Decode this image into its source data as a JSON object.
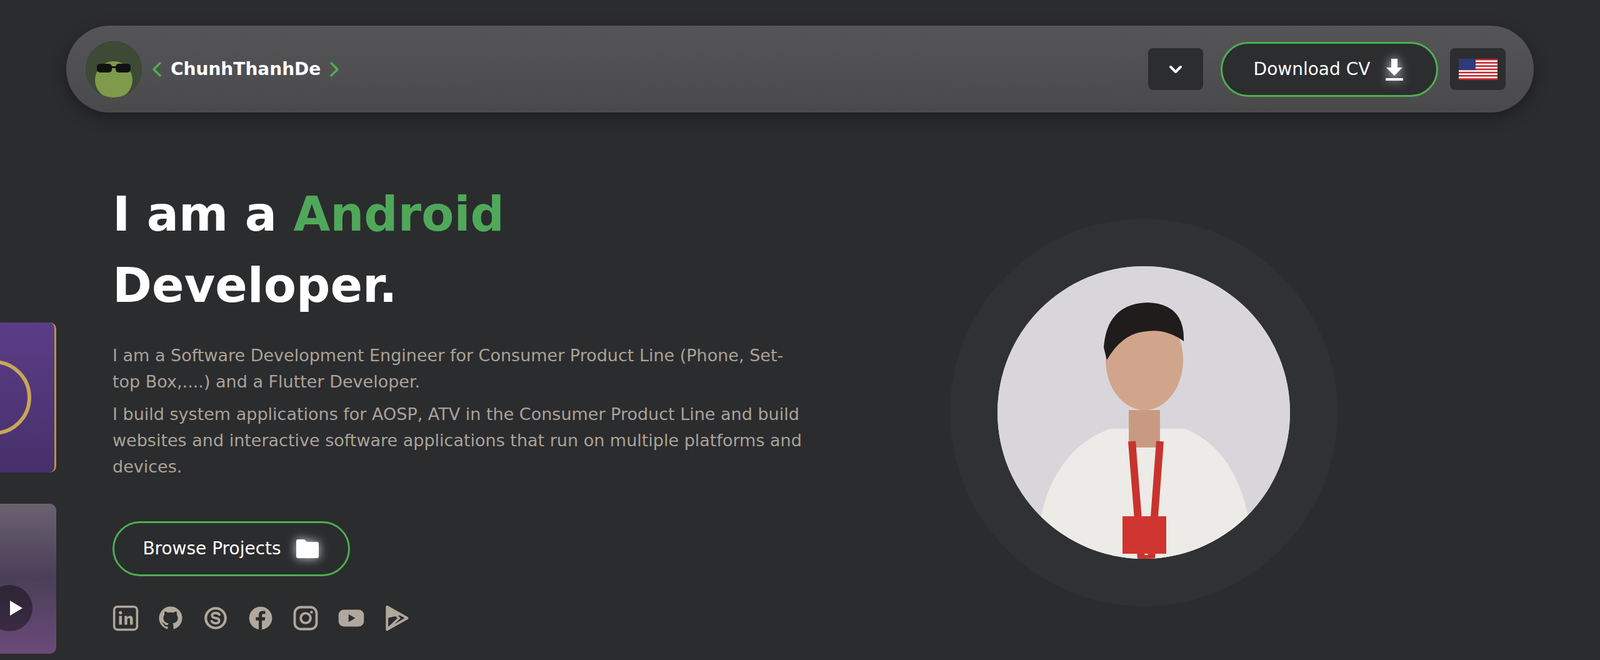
{
  "nav": {
    "name": "ChunhThanhDe",
    "download_button": "Download CV"
  },
  "hero": {
    "heading_prefix": "I am a",
    "heading_highlight": "Android",
    "heading_suffix": "Developer.",
    "paragraphs": [
      "I am a Software Development Engineer for Consumer Product Line (Phone, Set-top Box,....) and a Flutter Developer.",
      "I build system applications for AOSP, ATV in the Consumer Product Line and build websites and interactive software applications that run on multiple platforms and devices."
    ],
    "browse_button": "Browse Projects"
  },
  "side_media": [
    {
      "kind": "card"
    },
    {
      "kind": "video"
    }
  ]
}
